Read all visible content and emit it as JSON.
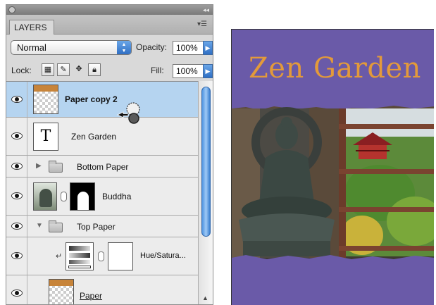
{
  "panel": {
    "tab_label": "LAYERS",
    "blend_mode": "Normal",
    "opacity_label": "Opacity:",
    "opacity_value": "100%",
    "lock_label": "Lock:",
    "fill_label": "Fill:",
    "fill_value": "100%"
  },
  "layers": [
    {
      "name": "Paper copy 2",
      "kind": "pixel",
      "selected": true,
      "visible": true
    },
    {
      "name": "Zen Garden",
      "kind": "text",
      "thumb_glyph": "T",
      "selected": false,
      "visible": true
    },
    {
      "name": "Bottom Paper",
      "kind": "group",
      "expanded": false,
      "selected": false,
      "visible": true
    },
    {
      "name": "Buddha",
      "kind": "masked",
      "selected": false,
      "visible": true
    },
    {
      "name": "Top Paper",
      "kind": "group",
      "expanded": true,
      "selected": false,
      "visible": true
    },
    {
      "name": "Hue/Satura...",
      "kind": "adjustment",
      "selected": false,
      "visible": true
    },
    {
      "name": "Paper",
      "kind": "pixel",
      "selected": false,
      "visible": true
    }
  ],
  "canvas": {
    "title": "Zen Garden",
    "paper_color": "#6a5aa8",
    "title_color": "#e39a3a"
  },
  "colors": {
    "selection": "#b5d4f0",
    "accent": "#3a7fd0"
  }
}
